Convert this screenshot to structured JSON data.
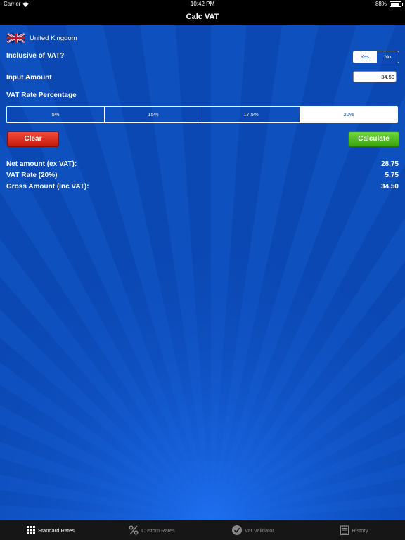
{
  "status": {
    "carrier": "Carrier",
    "time": "10:42 PM",
    "battery": "88%",
    "battery_level": 0.88
  },
  "nav": {
    "title": "Calc VAT"
  },
  "country": {
    "name": "United Kingdom",
    "flag": "uk-flag-icon"
  },
  "inclusive": {
    "label": "Inclusive of VAT?",
    "yes": "Yes",
    "no": "No",
    "selected": "Yes"
  },
  "input": {
    "label": "Input Amount",
    "value": "34.50"
  },
  "vat_rate": {
    "label": "VAT Rate Percentage",
    "options": [
      "5%",
      "15%",
      "17.5%",
      "20%"
    ],
    "selected": "20%"
  },
  "buttons": {
    "clear": "Clear",
    "calculate": "Calculate"
  },
  "results": [
    {
      "label": "Net amount (ex VAT):",
      "value": "28.75"
    },
    {
      "label": "VAT Rate (20%)",
      "value": "5.75"
    },
    {
      "label": "Gross Amount (inc VAT):",
      "value": "34.50"
    }
  ],
  "tabs": [
    {
      "label": "Standard Rates",
      "icon": "grid-icon",
      "active": true
    },
    {
      "label": "Custom Rates",
      "icon": "percent-icon",
      "active": false
    },
    {
      "label": "Vat Validator",
      "icon": "checkmark-icon",
      "active": false
    },
    {
      "label": "History",
      "icon": "notepad-icon",
      "active": false
    }
  ],
  "colors": {
    "background": "#0a49b8",
    "clear": "#d9271a",
    "calculate": "#4cba1f"
  }
}
